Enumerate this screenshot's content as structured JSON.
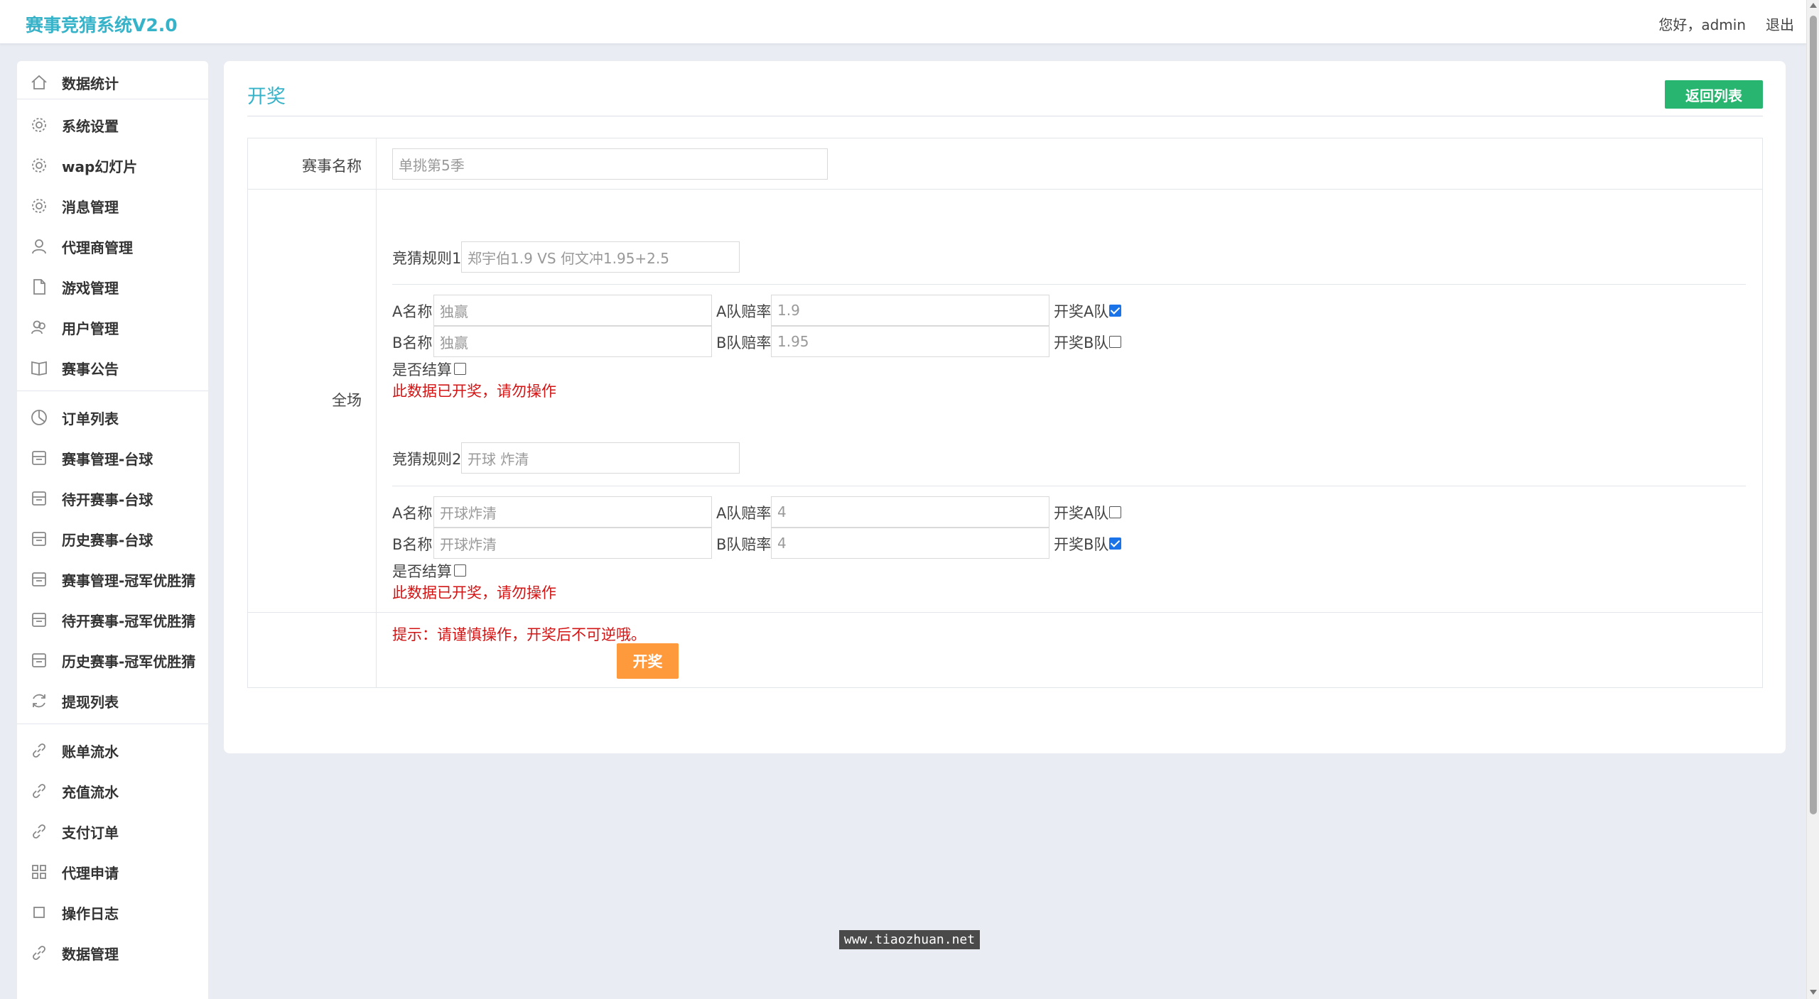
{
  "header": {
    "brand": "赛事竞猜系统V2.0",
    "greeting": "您好，admin",
    "logout": "退出"
  },
  "sidebar": {
    "items": [
      {
        "label": "数据统计",
        "icon": "home-icon"
      },
      {
        "label": "系统设置",
        "icon": "gear-icon"
      },
      {
        "label": "wap幻灯片",
        "icon": "gear-icon"
      },
      {
        "label": "消息管理",
        "icon": "gear-icon"
      },
      {
        "label": "代理商管理",
        "icon": "user-icon"
      },
      {
        "label": "游戏管理",
        "icon": "file-icon"
      },
      {
        "label": "用户管理",
        "icon": "users-icon"
      },
      {
        "label": "赛事公告",
        "icon": "book-icon"
      },
      {
        "label": "订单列表",
        "icon": "pie-icon"
      },
      {
        "label": "赛事管理-台球",
        "icon": "inbox-icon"
      },
      {
        "label": "待开赛事-台球",
        "icon": "inbox-icon"
      },
      {
        "label": "历史赛事-台球",
        "icon": "inbox-icon"
      },
      {
        "label": "赛事管理-冠军优胜猜",
        "icon": "inbox-icon"
      },
      {
        "label": "待开赛事-冠军优胜猜",
        "icon": "inbox-icon"
      },
      {
        "label": "历史赛事-冠军优胜猜",
        "icon": "inbox-icon"
      },
      {
        "label": "提现列表",
        "icon": "refresh-icon"
      },
      {
        "label": "账单流水",
        "icon": "link-icon"
      },
      {
        "label": "充值流水",
        "icon": "link-icon"
      },
      {
        "label": "支付订单",
        "icon": "link-icon"
      },
      {
        "label": "代理申请",
        "icon": "grid-icon"
      },
      {
        "label": "操作日志",
        "icon": "square-icon"
      },
      {
        "label": "数据管理",
        "icon": "link-icon"
      }
    ]
  },
  "main": {
    "title": "开奖",
    "back_button": "返回列表",
    "event_name_label": "赛事名称",
    "event_name_value": "单挑第5季",
    "section_label": "全场",
    "rule_label_1": "竞猜规则1",
    "rule_value_1": "郑宇伯1.9 VS 何文冲1.95+2.5",
    "rule1": {
      "a_name_label": "A名称",
      "a_name_value": "独赢",
      "a_odds_label": "A队赔率",
      "a_odds_value": "1.9",
      "a_open_label": "开奖A队",
      "a_open_checked": true,
      "b_name_label": "B名称",
      "b_name_value": "独赢",
      "b_odds_label": "B队赔率",
      "b_odds_value": "1.95",
      "b_open_label": "开奖B队",
      "b_open_checked": false,
      "settle_label": "是否结算",
      "settle_checked": false,
      "warning": "此数据已开奖，请勿操作"
    },
    "rule_label_2": "竞猜规则2",
    "rule_value_2": "开球 炸清",
    "rule2": {
      "a_name_label": "A名称",
      "a_name_value": "开球炸清",
      "a_odds_label": "A队赔率",
      "a_odds_value": "4",
      "a_open_label": "开奖A队",
      "a_open_checked": false,
      "b_name_label": "B名称",
      "b_name_value": "开球炸清",
      "b_odds_label": "B队赔率",
      "b_odds_value": "4",
      "b_open_label": "开奖B队",
      "b_open_checked": true,
      "settle_label": "是否结算",
      "settle_checked": false,
      "warning": "此数据已开奖，请勿操作"
    },
    "tip": "提示：请谨慎操作，开奖后不可逆哦。",
    "submit_button": "开奖"
  },
  "watermark": "www.tiaozhuan.net",
  "colors": {
    "brand": "#37b3c9",
    "back_button": "#27b56f",
    "submit_button": "#ff9a3c",
    "warning": "#d21414",
    "checkbox_checked": "#1a73e8"
  }
}
